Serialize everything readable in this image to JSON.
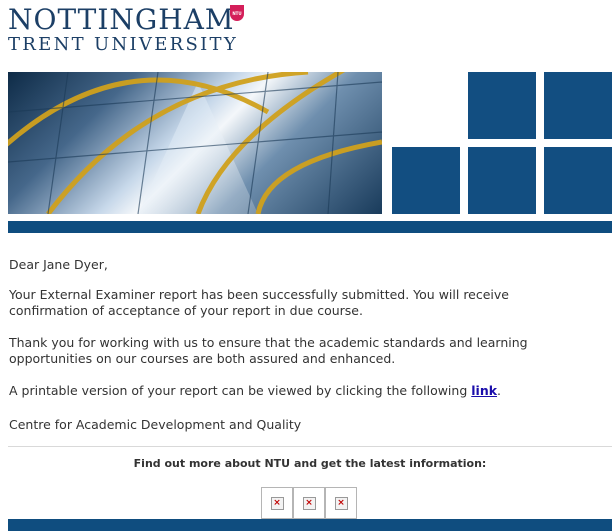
{
  "logo": {
    "line1": "NOTTINGHAM",
    "line2": "TRENT UNIVERSITY",
    "badge": "NTU",
    "colors": {
      "navy": "#1c3f66",
      "badge": "#d41f5a"
    }
  },
  "email": {
    "greeting": "Dear Jane Dyer,",
    "paragraph1": "Your External Examiner report has been successfully submitted. You will receive confirmation of acceptance of your report in due course.",
    "paragraph2": "Thank you for working with us to ensure that the academic standards and learning opportunities on our courses are both assured and enhanced.",
    "paragraph3_text": "A printable version of your report can be viewed by clicking the following ",
    "paragraph3_link": "link",
    "paragraph3_end": ".",
    "signature": "Centre for Academic Development and Quality"
  },
  "footer": {
    "find_more": "Find out more about NTU and get the latest information:",
    "social_icons": [
      "broken-image-icon",
      "broken-image-icon",
      "broken-image-icon"
    ],
    "bar_color": "#0f4d7f"
  }
}
